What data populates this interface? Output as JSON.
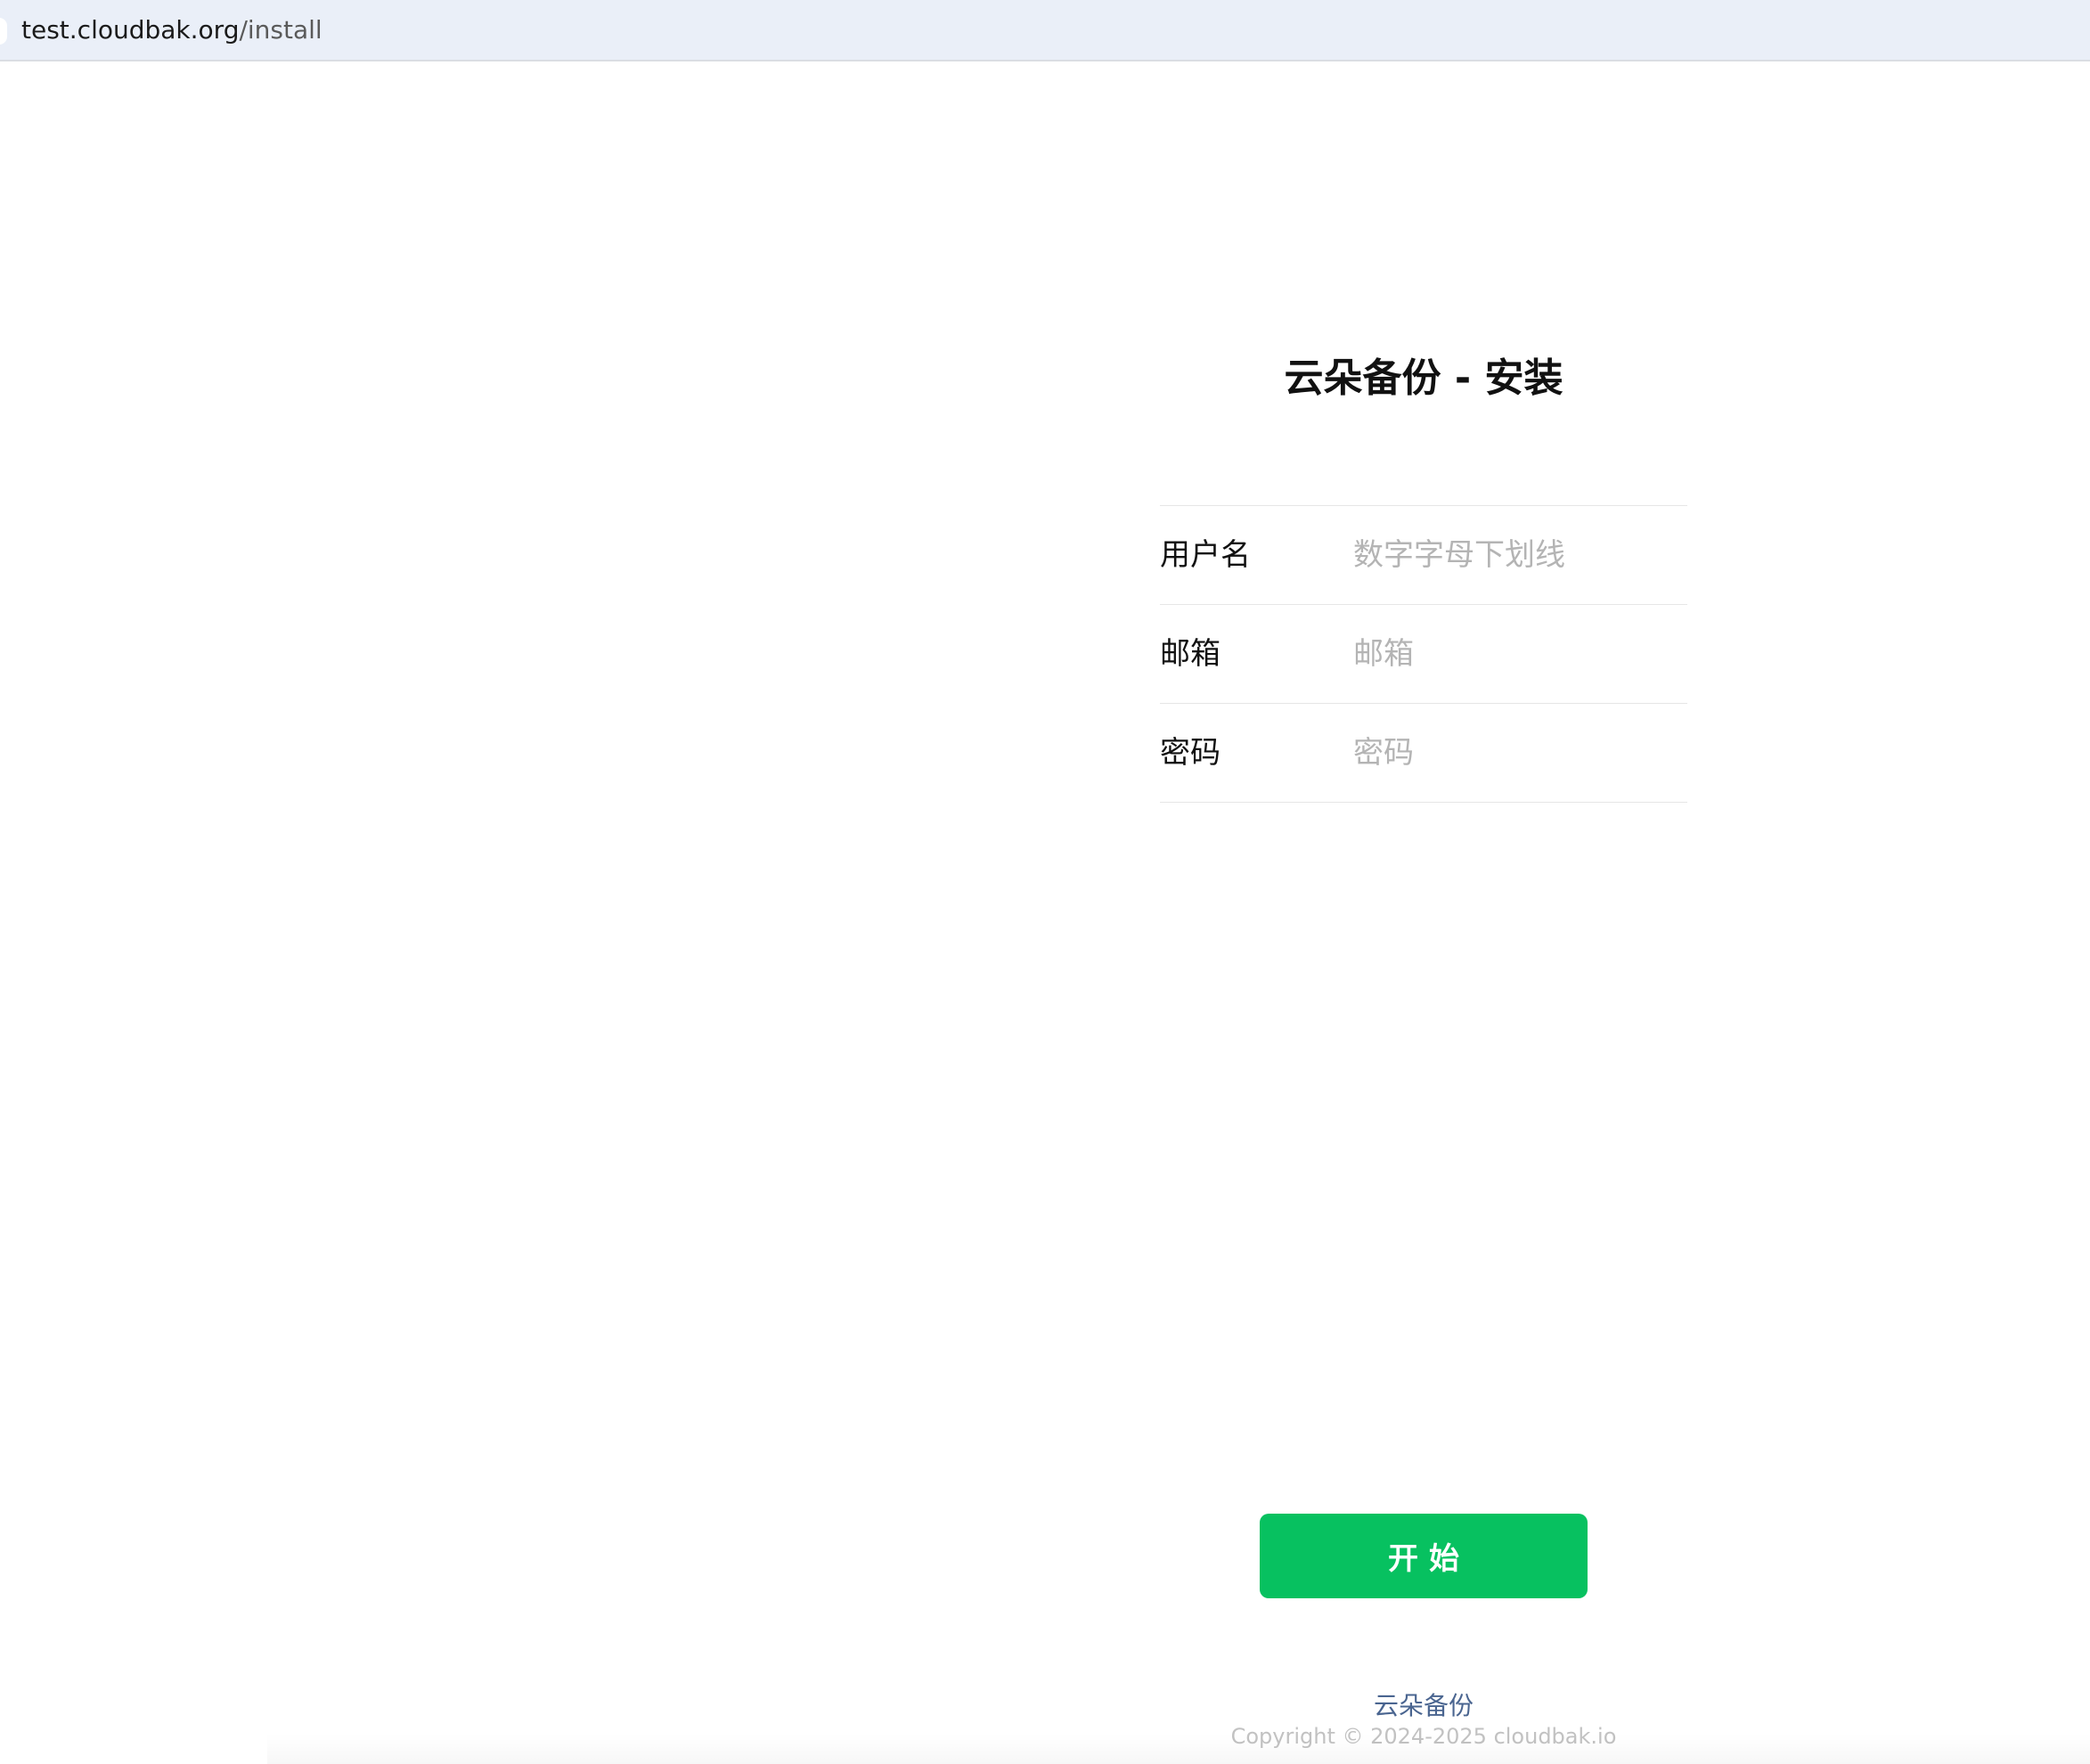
{
  "browser": {
    "url_host": "test.cloudbak.org",
    "url_path": "/install"
  },
  "page": {
    "title": "云朵备份 - 安装"
  },
  "form": {
    "username": {
      "label": "用户名",
      "placeholder": "数字字母下划线",
      "value": ""
    },
    "email": {
      "label": "邮箱",
      "placeholder": "邮箱",
      "value": ""
    },
    "password": {
      "label": "密码",
      "placeholder": "密码",
      "value": ""
    }
  },
  "actions": {
    "start_label": "开始"
  },
  "footer": {
    "brand": "云朵备份",
    "copyright": "Copyright © 2024-2025 cloudbak.io"
  },
  "colors": {
    "accent": "#07c160",
    "address_bar": "#eaeff8",
    "footer_link": "#4a6590",
    "placeholder": "#b4b4b4"
  }
}
